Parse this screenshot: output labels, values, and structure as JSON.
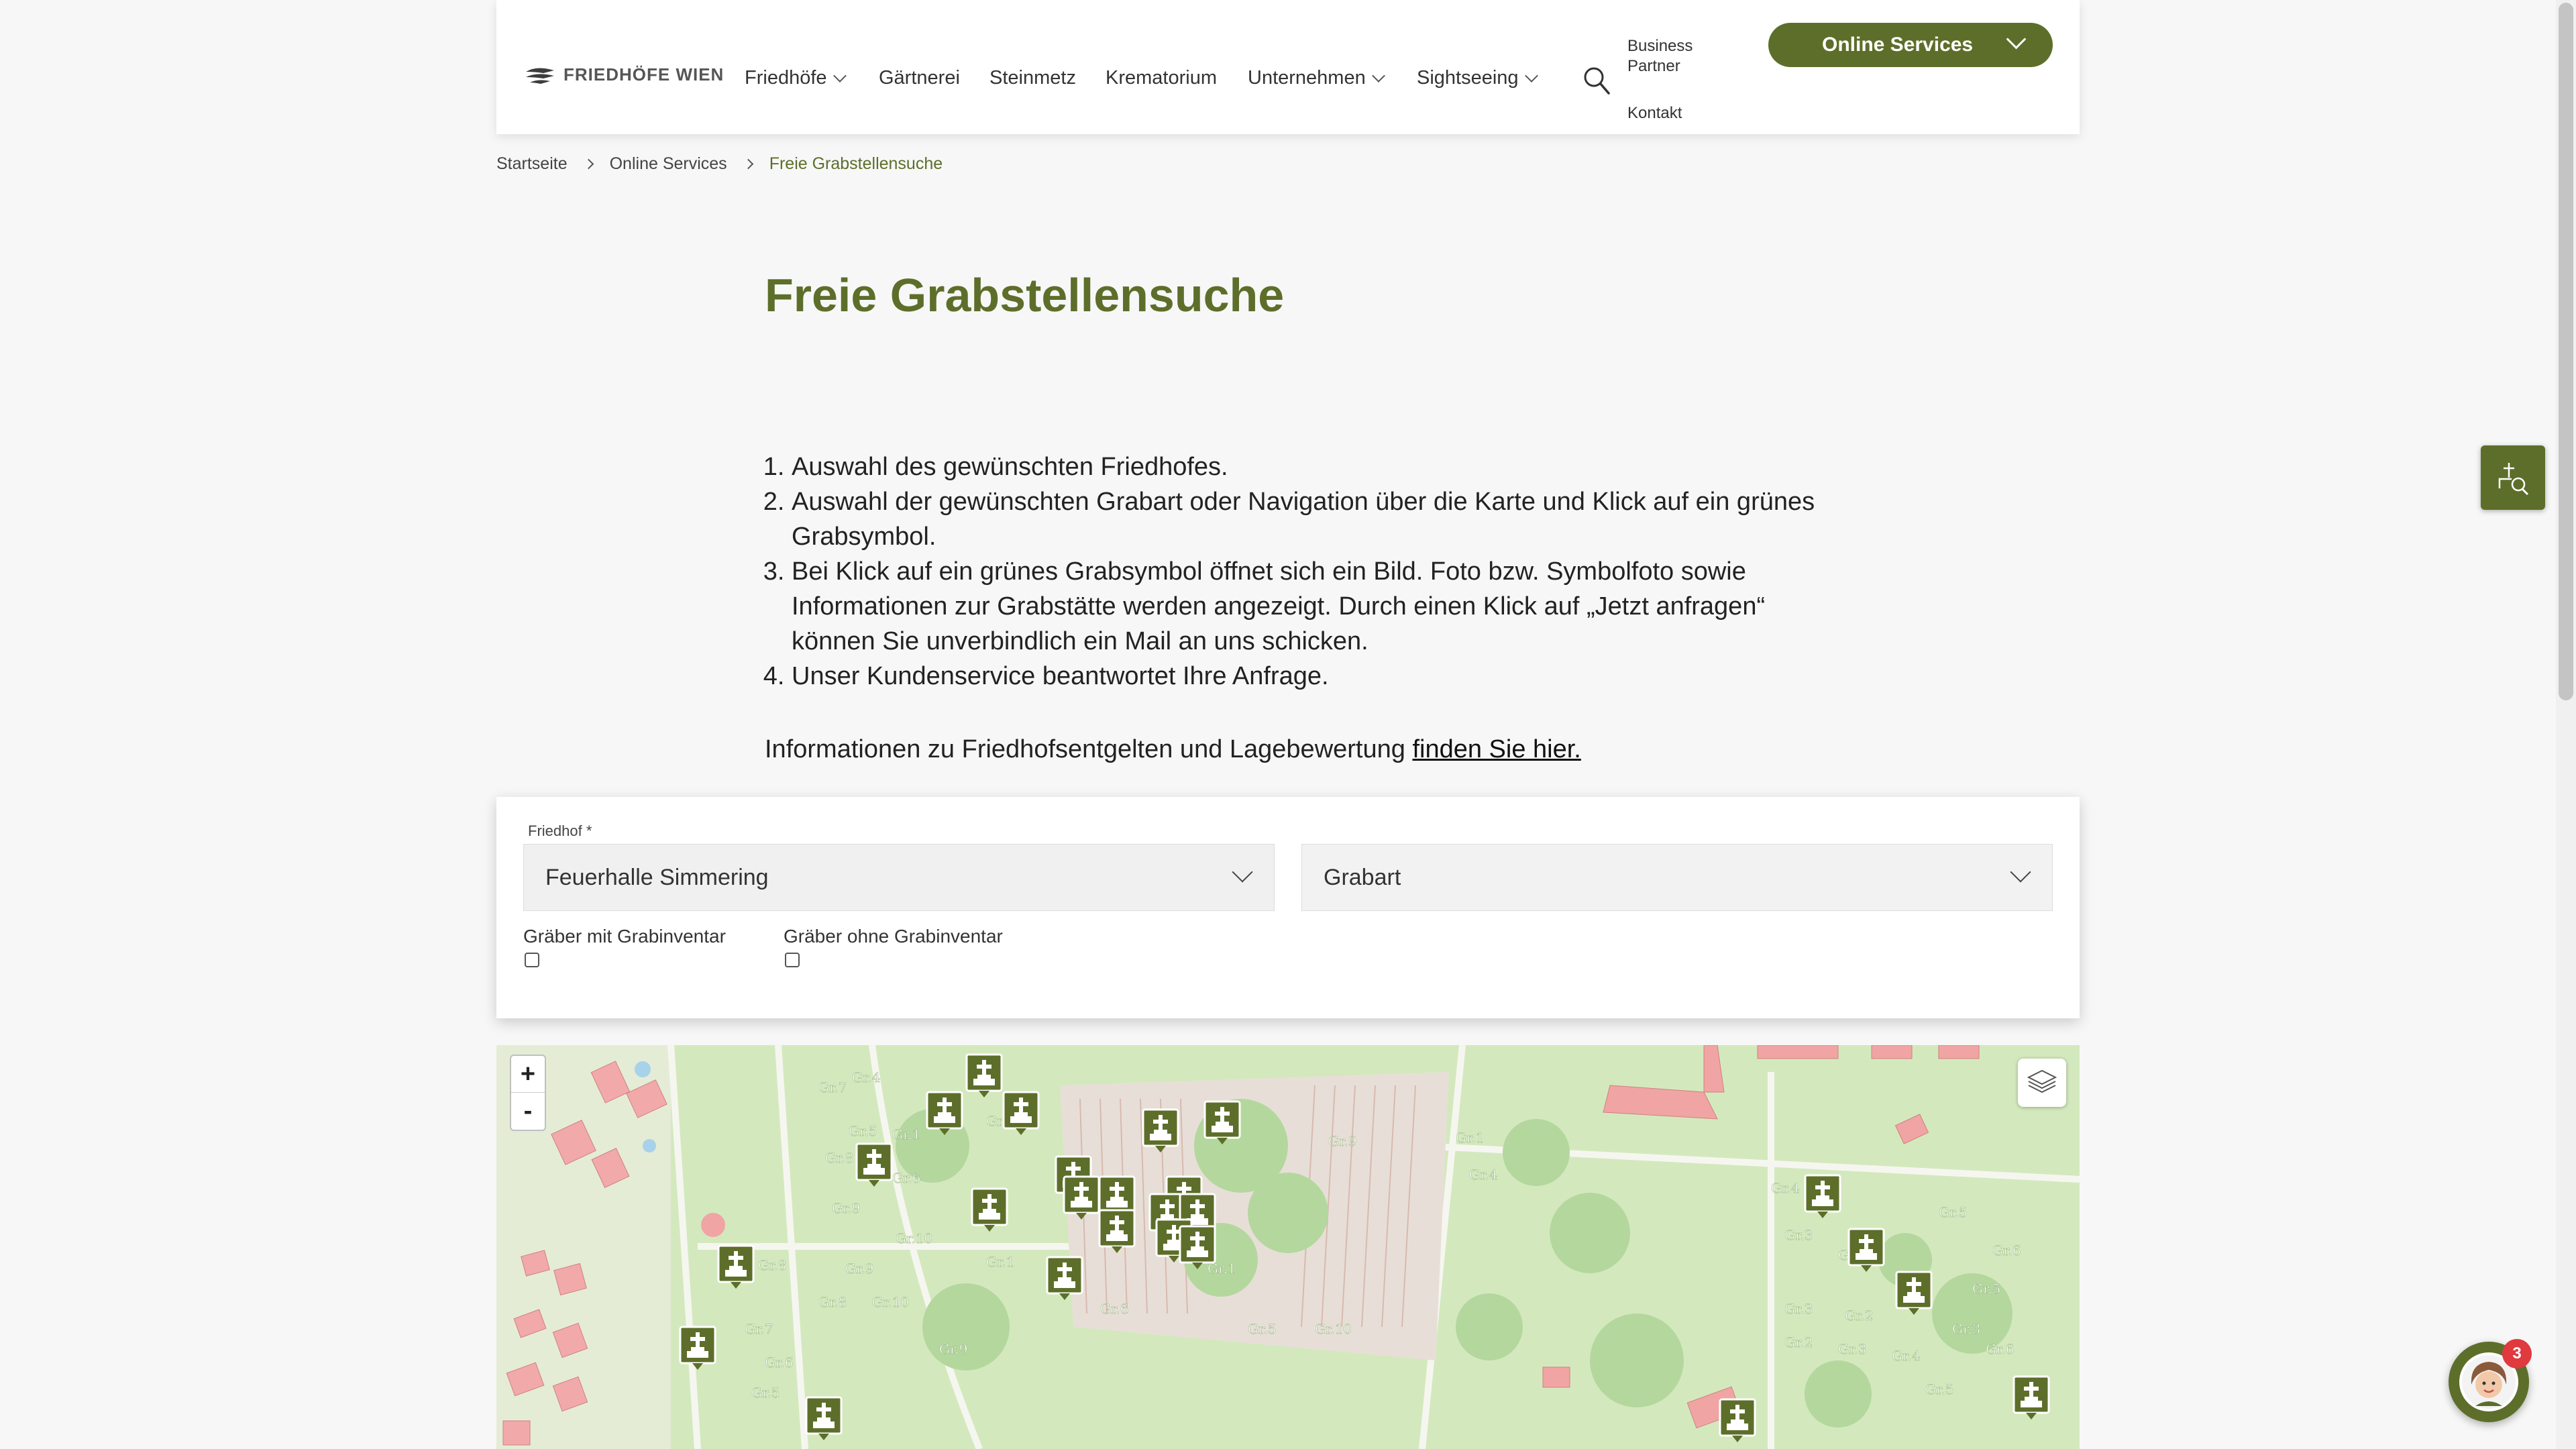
{
  "header": {
    "logo_text": "FRIEDHÖFE WIEN",
    "nav": [
      {
        "label": "Friedhöfe",
        "has_dropdown": true
      },
      {
        "label": "Gärtnerei",
        "has_dropdown": false
      },
      {
        "label": "Steinmetz",
        "has_dropdown": false
      },
      {
        "label": "Krematorium",
        "has_dropdown": false
      },
      {
        "label": "Unternehmen",
        "has_dropdown": true
      },
      {
        "label": "Sightseeing",
        "has_dropdown": true
      }
    ],
    "search_icon": "search-icon",
    "business_partner": "Business Partner",
    "kontakt": "Kontakt",
    "online_services": "Online Services"
  },
  "breadcrumb": [
    "Startseite",
    "Online Services",
    "Freie Grabstellensuche"
  ],
  "page": {
    "title": "Freie Grabstellensuche",
    "steps": [
      "Auswahl des gewünschten Friedhofes.",
      "Auswahl der gewünschten Grabart oder Navigation über die Karte und Klick auf ein grünes Grabsymbol.",
      "Bei Klick auf ein grünes Grabsymbol öffnet sich ein Bild. Foto bzw. Symbolfoto sowie Informationen zur Grabstätte werden angezeigt. Durch einen Klick auf „Jetzt anfragen“ können Sie unverbindlich ein Mail an uns schicken.",
      "Unser Kundenservice beantwortet Ihre Anfrage."
    ],
    "info_text": "Informationen zu Friedhofsentgelten und Lagebewertung ",
    "info_link": "finden Sie hier."
  },
  "filter": {
    "friedhof_label": "Friedhof *",
    "friedhof_value": "Feuerhalle Simmering",
    "grabart_placeholder": "Grabart",
    "checkbox_with": "Gräber mit Grabinventar",
    "checkbox_without": "Gräber ohne Grabinventar",
    "checkbox_with_checked": false,
    "checkbox_without_checked": false
  },
  "map": {
    "zoom_in": "+",
    "zoom_out": "-",
    "layers_icon": "layers-icon",
    "grave_icon": "grave-marker-icon",
    "group_labels": [
      "Gr.1",
      "Gr.2",
      "Gr.3",
      "Gr.4",
      "Gr.5",
      "Gr.6",
      "Gr.7",
      "Gr.8",
      "Gr.9",
      "Gr.10"
    ]
  },
  "widgets": {
    "side_tool_icon": "grave-search-icon",
    "chat_icon": "chat-avatar-icon",
    "chat_badge": "3"
  },
  "colors": {
    "brand_green": "#5d6e2a",
    "map_green": "#cfe7b8",
    "building_red": "#f0a0a0",
    "badge_red": "#e0393e"
  }
}
